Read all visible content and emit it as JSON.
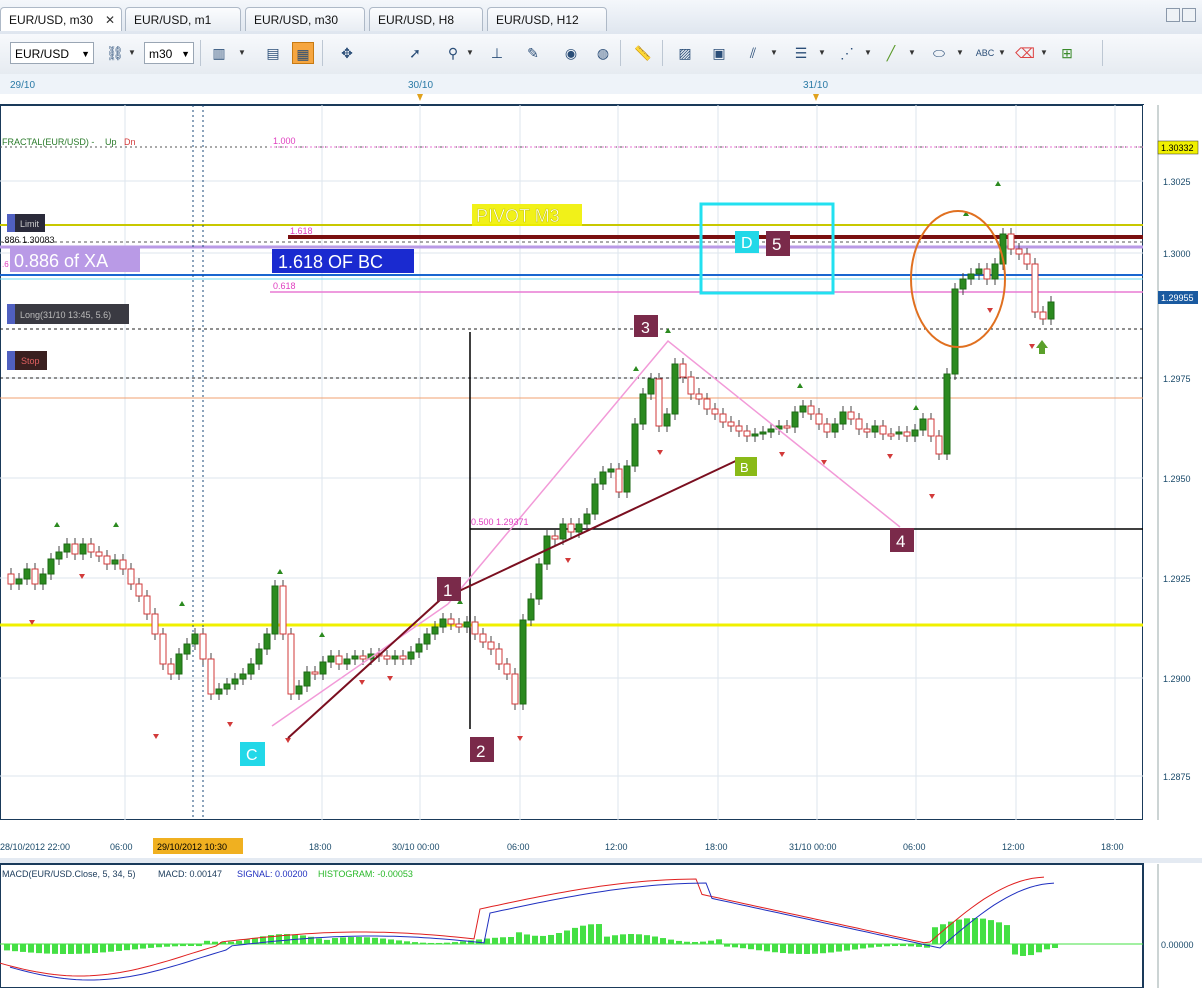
{
  "tabs": [
    {
      "label": "EUR/USD, m30",
      "active": true
    },
    {
      "label": "EUR/USD, m1",
      "active": false
    },
    {
      "label": "EUR/USD, m30",
      "active": false
    },
    {
      "label": "EUR/USD, H8",
      "active": false
    },
    {
      "label": "EUR/USD, H12",
      "active": false
    }
  ],
  "toolbar": {
    "symbol": "EUR/USD",
    "timeframe": "m30",
    "icons": [
      "link-icon",
      "chart-type-icon",
      "layout-icon",
      "indicators-icon",
      "crosshair-icon",
      "magnifier-icon",
      "period-separator-icon",
      "chart-edit-icon",
      "eye-icon",
      "globe-icon",
      "ruler-icon",
      "screenshot-icon",
      "template-icon",
      "trend-tools-icon",
      "horizontal-lines-icon",
      "fan-icon",
      "line-icon",
      "ellipse-icon",
      "text-icon",
      "eraser-icon",
      "tree-icon"
    ]
  },
  "top_dates": [
    "29/10",
    "30/10",
    "31/10"
  ],
  "price_axis": {
    "labels": [
      "1.3025",
      "1.3000",
      "1.2975",
      "1.2950",
      "1.2925",
      "1.2900",
      "1.2875"
    ],
    "current_price": "1.29955",
    "top_price": "1.30332"
  },
  "time_axis": {
    "labels": [
      "28/10/2012 22:00",
      "06:00",
      "18:00",
      "30/10 00:00",
      "06:00",
      "12:00",
      "18:00",
      "31/10 00:00",
      "06:00",
      "12:00",
      "18:00"
    ],
    "cursor_label": "29/10/2012 10:30"
  },
  "indicator_label": {
    "prefix": "FRACTAL(EUR/USD) -",
    "up": "Up",
    "dn": "Dn"
  },
  "fib_labels": {
    "top": "1.000",
    "mid": "1.618",
    "low": "0.618",
    "left": ".886  1.30083",
    "left_small": ".6",
    "half": "0.500  1.29371"
  },
  "orders": {
    "limit": "Limit",
    "long": "Long(31/10 13:45, 5.6)",
    "stop": "Stop"
  },
  "annotations": {
    "pivot": "PIVOT M3",
    "xa": "0.886 of XA",
    "bc": "1.618 OF BC",
    "point_d": "D",
    "point_b": "B",
    "point_c": "C",
    "wave": [
      "1",
      "2",
      "3",
      "4",
      "5"
    ]
  },
  "macd": {
    "title": "MACD(EUR/USD.Close, 5, 34, 5)",
    "macd_label": "MACD: 0.00147",
    "signal_label": "SIGNAL: 0.00200",
    "histogram_label": "HISTOGRAM: -0.00053",
    "zero": "0.00000"
  },
  "colors": {
    "bull": "#2b8a1f",
    "bear": "#d23a3a",
    "pivot": "#f0f000",
    "fibpink": "#e97ad4",
    "macd": "#e02020",
    "signal": "#2030c0",
    "hist": "#44e044"
  }
}
